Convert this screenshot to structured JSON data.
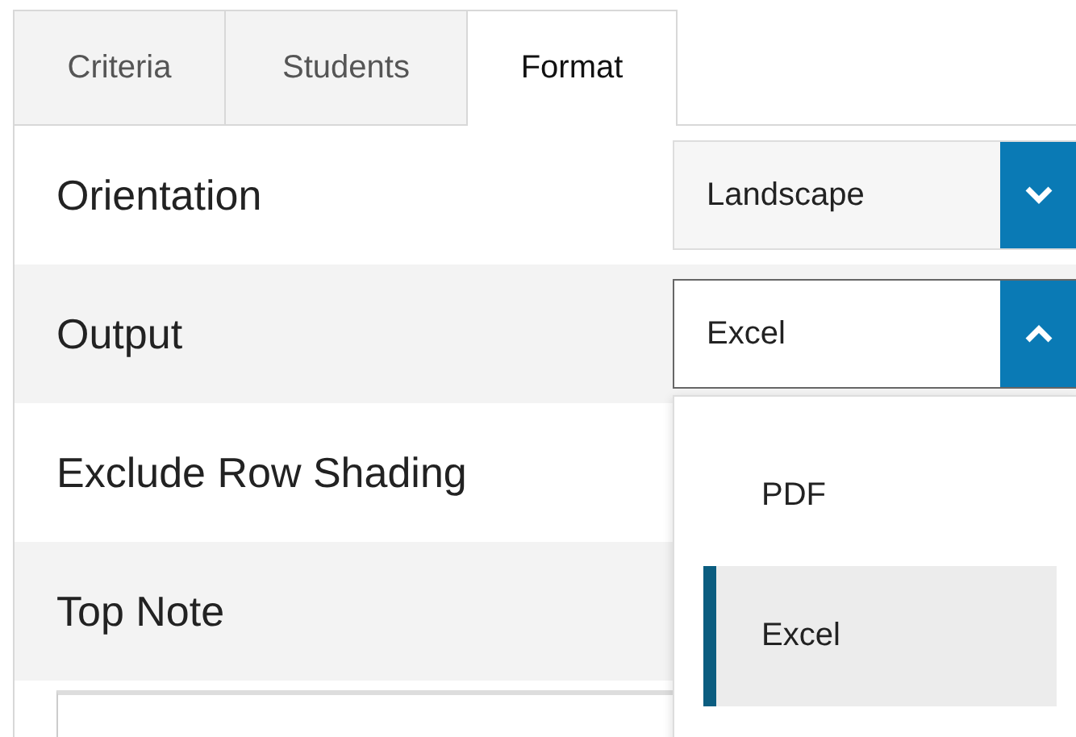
{
  "tabs": [
    {
      "label": "Criteria",
      "selected": false
    },
    {
      "label": "Students",
      "selected": false
    },
    {
      "label": "Format",
      "selected": true
    }
  ],
  "fields": [
    {
      "label": "Orientation",
      "kind": "select",
      "value": "Landscape",
      "open": false
    },
    {
      "label": "Output",
      "kind": "select",
      "value": "Excel",
      "open": true,
      "options": [
        {
          "label": "PDF",
          "selected": false
        },
        {
          "label": "Excel",
          "selected": true
        }
      ]
    },
    {
      "label": "Exclude Row Shading",
      "kind": "plain"
    },
    {
      "label": "Top Note",
      "kind": "note"
    }
  ]
}
